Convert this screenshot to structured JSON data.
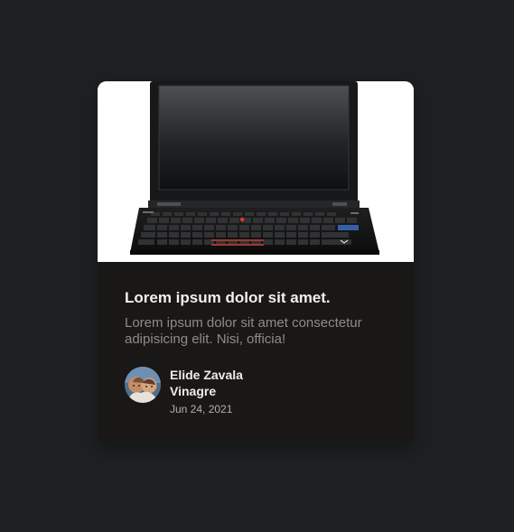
{
  "card": {
    "image_alt": "laptop-image",
    "title": "Lorem ipsum dolor sit amet.",
    "description": "Lorem ipsum dolor sit amet consectetur adipisicing elit. Nisi, officia!",
    "author": {
      "name": "Elide Zavala Vinagre",
      "date": "Jun 24, 2021"
    }
  },
  "colors": {
    "page_background": "#1e2121",
    "card_background": "#191816",
    "title": "#f3efe9",
    "description": "#8f8c86",
    "date": "#b4afa8"
  }
}
